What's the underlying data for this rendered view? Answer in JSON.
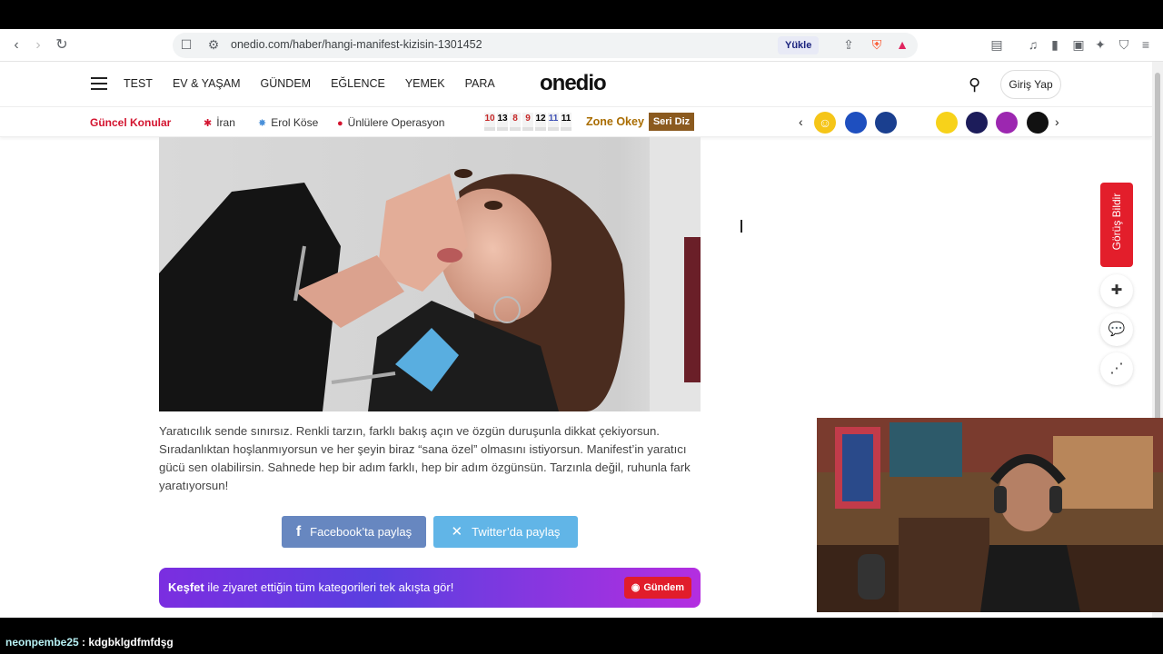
{
  "browser": {
    "url": "onedio.com/haber/hangi-manifest-kizisin-1301452",
    "upload_label": "Yükle",
    "icons": [
      "back-icon",
      "forward-icon",
      "reload-icon",
      "bookmark-icon",
      "site-settings-icon",
      "share-icon",
      "brave-shield-icon",
      "brave-rewards-icon",
      "reader-mode-icon",
      "media-icon",
      "sidebar-icon",
      "wallet-icon",
      "ai-icon",
      "vpn-icon",
      "menu-icon"
    ]
  },
  "site": {
    "logo": "onedio",
    "menu": [
      "TEST",
      "EV & YAŞAM",
      "GÜNDEM",
      "EĞLENCE",
      "YEMEK",
      "PARA"
    ],
    "login_label": "Giriş Yap"
  },
  "topics": {
    "label": "Güncel Konular",
    "items": [
      "İran",
      "Erol Köse",
      "Ünlülere Operasyon"
    ],
    "numbers": [
      "10",
      "13",
      "8",
      "9",
      "12",
      "11",
      "11"
    ],
    "number_colors": [
      "#c62828",
      "#222222",
      "#c62828",
      "#c62828",
      "#222222",
      "#3f51b5",
      "#222222"
    ],
    "zone_label": "Zone Okey",
    "seri_diz_label": "Seri Diz",
    "brand_colors": [
      "#f5c518",
      "#1e4fbf",
      "#1a3f8f",
      "#ffffff",
      "#f7d21a",
      "#1c1c5a",
      "#9c27b0",
      "#111111"
    ]
  },
  "article": {
    "paragraph": "Yaratıcılık sende sınırsız. Renkli tarzın, farklı bakış açın ve özgün duruşunla dikkat çekiyorsun. Sıradanlıktan hoşlanmıyorsun ve her şeyin biraz “sana özel” olmasını istiyorsun. Manifest’in yaratıcı gücü sen olabilirsin. Sahnede hep bir adım farklı, hep bir adım özgünsün. Tarzınla değil, ruhunla fark yaratıyorsun!",
    "facebook_share": "Facebook’ta paylaş",
    "twitter_share": "Twitter’da paylaş",
    "discover_bold": "Keşfet",
    "discover_text": " ile ziyaret ettiğin tüm kategorileri tek akışta gör!",
    "gundem_label": "Gündem"
  },
  "sidebar": {
    "feedback_label": "Görüş Bildir"
  },
  "chat": {
    "username": "neonpembe25",
    "message": " : kdgbklgdfmfdşg"
  }
}
